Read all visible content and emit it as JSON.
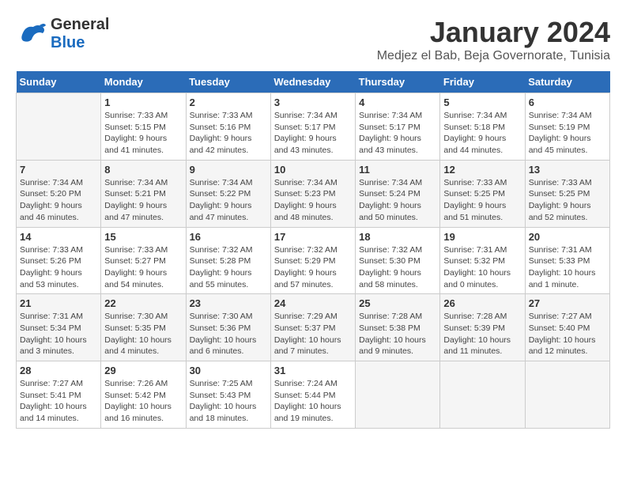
{
  "header": {
    "logo_general": "General",
    "logo_blue": "Blue",
    "month_title": "January 2024",
    "subtitle": "Medjez el Bab, Beja Governorate, Tunisia"
  },
  "calendar": {
    "days_of_week": [
      "Sunday",
      "Monday",
      "Tuesday",
      "Wednesday",
      "Thursday",
      "Friday",
      "Saturday"
    ],
    "weeks": [
      [
        {
          "day": "",
          "info": ""
        },
        {
          "day": "1",
          "info": "Sunrise: 7:33 AM\nSunset: 5:15 PM\nDaylight: 9 hours\nand 41 minutes."
        },
        {
          "day": "2",
          "info": "Sunrise: 7:33 AM\nSunset: 5:16 PM\nDaylight: 9 hours\nand 42 minutes."
        },
        {
          "day": "3",
          "info": "Sunrise: 7:34 AM\nSunset: 5:17 PM\nDaylight: 9 hours\nand 43 minutes."
        },
        {
          "day": "4",
          "info": "Sunrise: 7:34 AM\nSunset: 5:17 PM\nDaylight: 9 hours\nand 43 minutes."
        },
        {
          "day": "5",
          "info": "Sunrise: 7:34 AM\nSunset: 5:18 PM\nDaylight: 9 hours\nand 44 minutes."
        },
        {
          "day": "6",
          "info": "Sunrise: 7:34 AM\nSunset: 5:19 PM\nDaylight: 9 hours\nand 45 minutes."
        }
      ],
      [
        {
          "day": "7",
          "info": "Sunrise: 7:34 AM\nSunset: 5:20 PM\nDaylight: 9 hours\nand 46 minutes."
        },
        {
          "day": "8",
          "info": "Sunrise: 7:34 AM\nSunset: 5:21 PM\nDaylight: 9 hours\nand 47 minutes."
        },
        {
          "day": "9",
          "info": "Sunrise: 7:34 AM\nSunset: 5:22 PM\nDaylight: 9 hours\nand 47 minutes."
        },
        {
          "day": "10",
          "info": "Sunrise: 7:34 AM\nSunset: 5:23 PM\nDaylight: 9 hours\nand 48 minutes."
        },
        {
          "day": "11",
          "info": "Sunrise: 7:34 AM\nSunset: 5:24 PM\nDaylight: 9 hours\nand 50 minutes."
        },
        {
          "day": "12",
          "info": "Sunrise: 7:33 AM\nSunset: 5:25 PM\nDaylight: 9 hours\nand 51 minutes."
        },
        {
          "day": "13",
          "info": "Sunrise: 7:33 AM\nSunset: 5:25 PM\nDaylight: 9 hours\nand 52 minutes."
        }
      ],
      [
        {
          "day": "14",
          "info": "Sunrise: 7:33 AM\nSunset: 5:26 PM\nDaylight: 9 hours\nand 53 minutes."
        },
        {
          "day": "15",
          "info": "Sunrise: 7:33 AM\nSunset: 5:27 PM\nDaylight: 9 hours\nand 54 minutes."
        },
        {
          "day": "16",
          "info": "Sunrise: 7:32 AM\nSunset: 5:28 PM\nDaylight: 9 hours\nand 55 minutes."
        },
        {
          "day": "17",
          "info": "Sunrise: 7:32 AM\nSunset: 5:29 PM\nDaylight: 9 hours\nand 57 minutes."
        },
        {
          "day": "18",
          "info": "Sunrise: 7:32 AM\nSunset: 5:30 PM\nDaylight: 9 hours\nand 58 minutes."
        },
        {
          "day": "19",
          "info": "Sunrise: 7:31 AM\nSunset: 5:32 PM\nDaylight: 10 hours\nand 0 minutes."
        },
        {
          "day": "20",
          "info": "Sunrise: 7:31 AM\nSunset: 5:33 PM\nDaylight: 10 hours\nand 1 minute."
        }
      ],
      [
        {
          "day": "21",
          "info": "Sunrise: 7:31 AM\nSunset: 5:34 PM\nDaylight: 10 hours\nand 3 minutes."
        },
        {
          "day": "22",
          "info": "Sunrise: 7:30 AM\nSunset: 5:35 PM\nDaylight: 10 hours\nand 4 minutes."
        },
        {
          "day": "23",
          "info": "Sunrise: 7:30 AM\nSunset: 5:36 PM\nDaylight: 10 hours\nand 6 minutes."
        },
        {
          "day": "24",
          "info": "Sunrise: 7:29 AM\nSunset: 5:37 PM\nDaylight: 10 hours\nand 7 minutes."
        },
        {
          "day": "25",
          "info": "Sunrise: 7:28 AM\nSunset: 5:38 PM\nDaylight: 10 hours\nand 9 minutes."
        },
        {
          "day": "26",
          "info": "Sunrise: 7:28 AM\nSunset: 5:39 PM\nDaylight: 10 hours\nand 11 minutes."
        },
        {
          "day": "27",
          "info": "Sunrise: 7:27 AM\nSunset: 5:40 PM\nDaylight: 10 hours\nand 12 minutes."
        }
      ],
      [
        {
          "day": "28",
          "info": "Sunrise: 7:27 AM\nSunset: 5:41 PM\nDaylight: 10 hours\nand 14 minutes."
        },
        {
          "day": "29",
          "info": "Sunrise: 7:26 AM\nSunset: 5:42 PM\nDaylight: 10 hours\nand 16 minutes."
        },
        {
          "day": "30",
          "info": "Sunrise: 7:25 AM\nSunset: 5:43 PM\nDaylight: 10 hours\nand 18 minutes."
        },
        {
          "day": "31",
          "info": "Sunrise: 7:24 AM\nSunset: 5:44 PM\nDaylight: 10 hours\nand 19 minutes."
        },
        {
          "day": "",
          "info": ""
        },
        {
          "day": "",
          "info": ""
        },
        {
          "day": "",
          "info": ""
        }
      ]
    ]
  }
}
